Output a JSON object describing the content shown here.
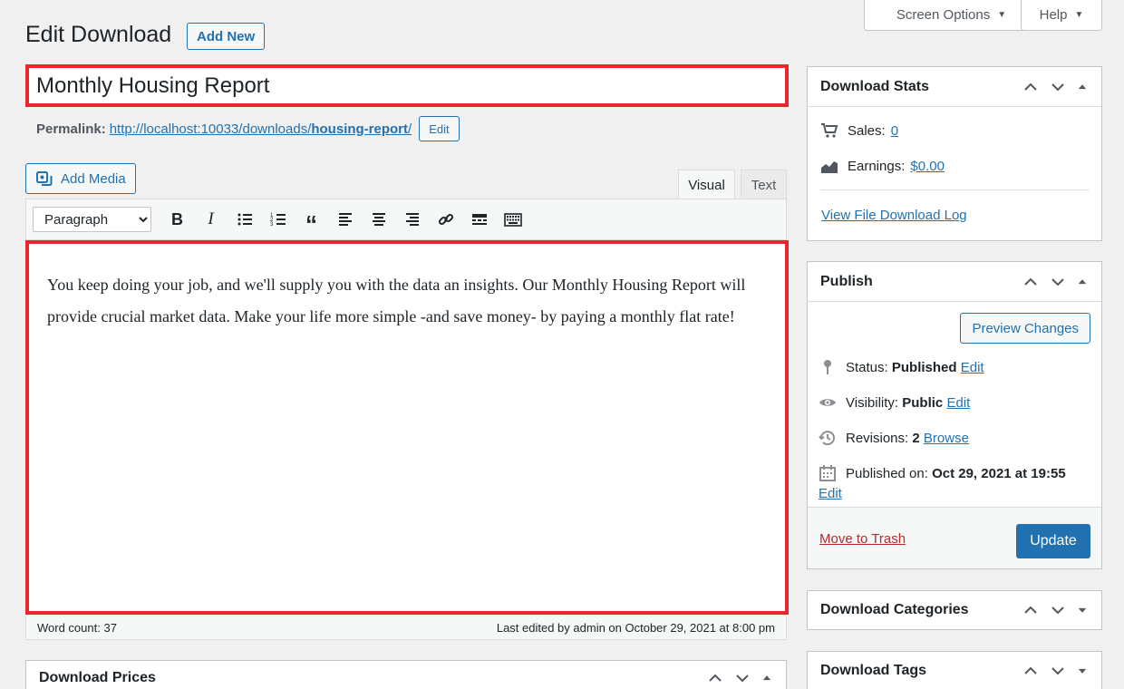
{
  "screen_options": {
    "label": "Screen Options"
  },
  "help": {
    "label": "Help"
  },
  "page": {
    "title": "Edit Download",
    "add_new": "Add New"
  },
  "post": {
    "title": "Monthly Housing Report",
    "permalink_label": "Permalink:",
    "permalink_base": "http://localhost:10033/downloads/",
    "permalink_slug": "housing-report",
    "permalink_trail": "/",
    "permalink_edit": "Edit"
  },
  "editor": {
    "add_media": "Add Media",
    "tab_visual": "Visual",
    "tab_text": "Text",
    "format_select": "Paragraph",
    "content": "You keep doing your job, and we'll supply you with the data an insights. Our Monthly Housing Report will provide crucial market data. Make your life more simple -and save money- by paying a monthly flat rate!",
    "word_count": "Word count: 37",
    "last_edited": "Last edited by admin on October 29, 2021 at 8:00 pm"
  },
  "download_prices": {
    "title": "Download Prices"
  },
  "download_stats": {
    "title": "Download Stats",
    "sales_label": "Sales:",
    "sales_value": "0",
    "earnings_label": "Earnings:",
    "earnings_value": "$0.00",
    "log_link": "View File Download Log"
  },
  "publish": {
    "title": "Publish",
    "preview": "Preview Changes",
    "status_label": "Status:",
    "status_value": "Published",
    "visibility_label": "Visibility:",
    "visibility_value": "Public",
    "revisions_label": "Revisions:",
    "revisions_value": "2",
    "browse": "Browse",
    "published_label": "Published on:",
    "published_value": "Oct 29, 2021 at 19:55",
    "edit": "Edit",
    "trash": "Move to Trash",
    "update": "Update"
  },
  "download_categories": {
    "title": "Download Categories"
  },
  "download_tags": {
    "title": "Download Tags"
  },
  "colors": {
    "accent": "#2271b1",
    "highlight": "#e8262b",
    "danger": "#b32d2e"
  }
}
